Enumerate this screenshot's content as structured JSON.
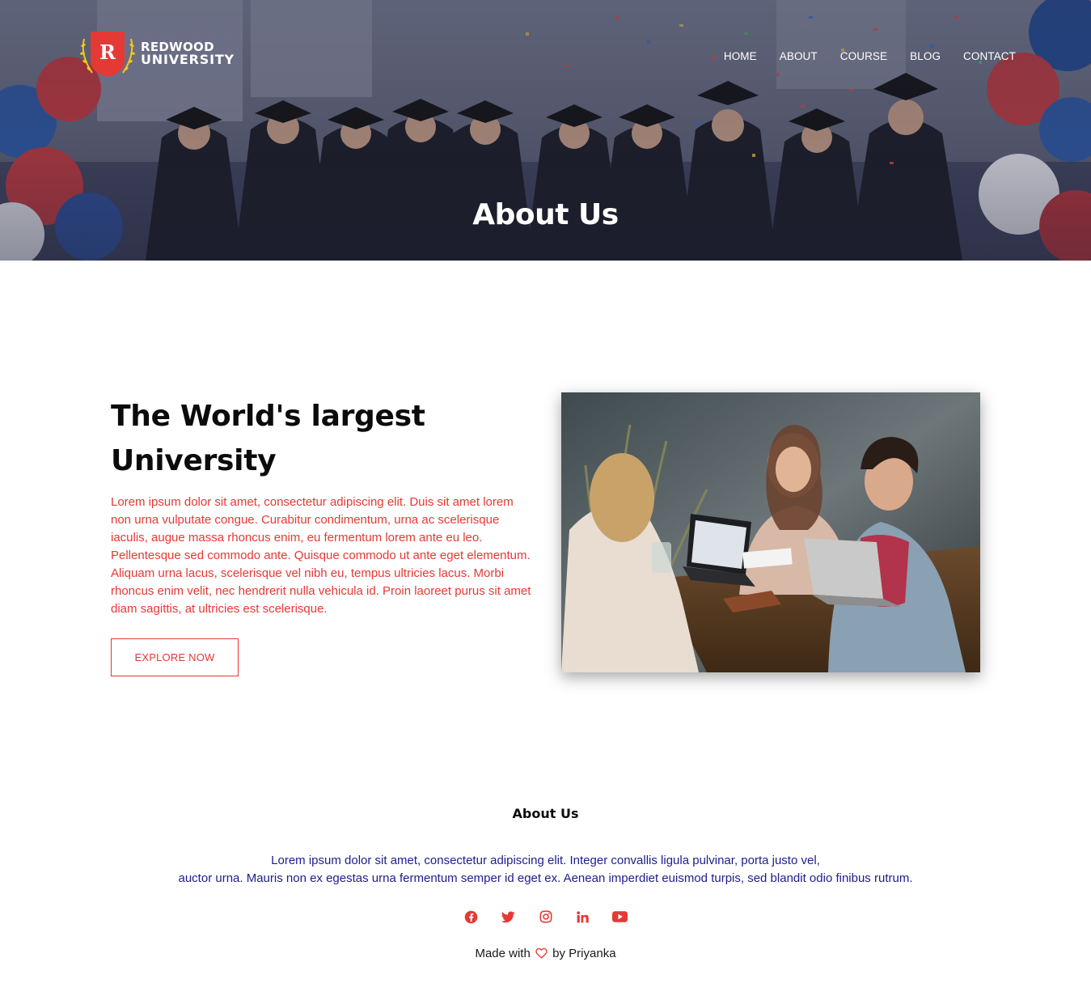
{
  "brand": {
    "logo_letter": "R",
    "name_line1": "REDWOOD",
    "name_line2": "UNIVERSITY",
    "accent_color": "#e53935",
    "laurel_color": "#f5c518"
  },
  "nav": {
    "items": [
      {
        "label": "HOME"
      },
      {
        "label": "ABOUT"
      },
      {
        "label": "COURSE"
      },
      {
        "label": "BLOG"
      },
      {
        "label": "CONTACT"
      }
    ]
  },
  "hero": {
    "title": "About Us"
  },
  "feature": {
    "heading_line1": "The World's largest",
    "heading_line2": "University",
    "body": "Lorem ipsum dolor sit amet, consectetur adipiscing elit. Duis sit amet lorem non urna vulputate congue. Curabitur condimentum, urna ac scelerisque iaculis, augue massa rhoncus enim, eu fermentum lorem ante eu leo. Pellentesque sed commodo ante. Quisque commodo ut ante eget elementum. Aliquam urna lacus, scelerisque vel nibh eu, tempus ultricies lacus. Morbi rhoncus enim velit, nec hendrerit nulla vehicula id. Proin laoreet purus sit amet diam sagittis, at ultricies est scelerisque.",
    "button_label": "EXPLORE NOW",
    "body_color": "#e53935"
  },
  "footer": {
    "title": "About Us",
    "text_line1": "Lorem ipsum dolor sit amet, consectetur adipiscing elit. Integer convallis ligula pulvinar, porta justo vel,",
    "text_line2": "auctor urna. Mauris non ex egestas urna fermentum semper id eget ex. Aenean imperdiet euismod turpis, sed blandit odio finibus rutrum.",
    "text_color": "#1d1d8f",
    "socials": [
      {
        "icon": "facebook-icon"
      },
      {
        "icon": "twitter-icon"
      },
      {
        "icon": "instagram-icon"
      },
      {
        "icon": "linkedin-icon"
      },
      {
        "icon": "youtube-icon"
      }
    ],
    "made_with_prefix": "Made with",
    "made_with_suffix": "by Priyanka",
    "heart_icon": "heart-icon"
  }
}
